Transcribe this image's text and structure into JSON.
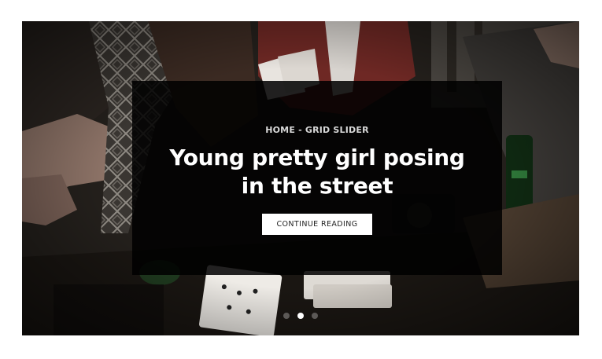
{
  "slide": {
    "category": "HOME - GRID SLIDER",
    "title": "Young pretty girl posing in the street",
    "cta_label": "CONTINUE READING",
    "image_icon": "card-game-photo"
  },
  "pagination": {
    "count": 3,
    "active_index": 1
  },
  "colors": {
    "overlay": "#000000",
    "text": "#ffffff",
    "button_bg": "#ffffff",
    "button_text": "#222222",
    "dot_inactive": "#5c5956",
    "dot_active": "#ffffff"
  }
}
